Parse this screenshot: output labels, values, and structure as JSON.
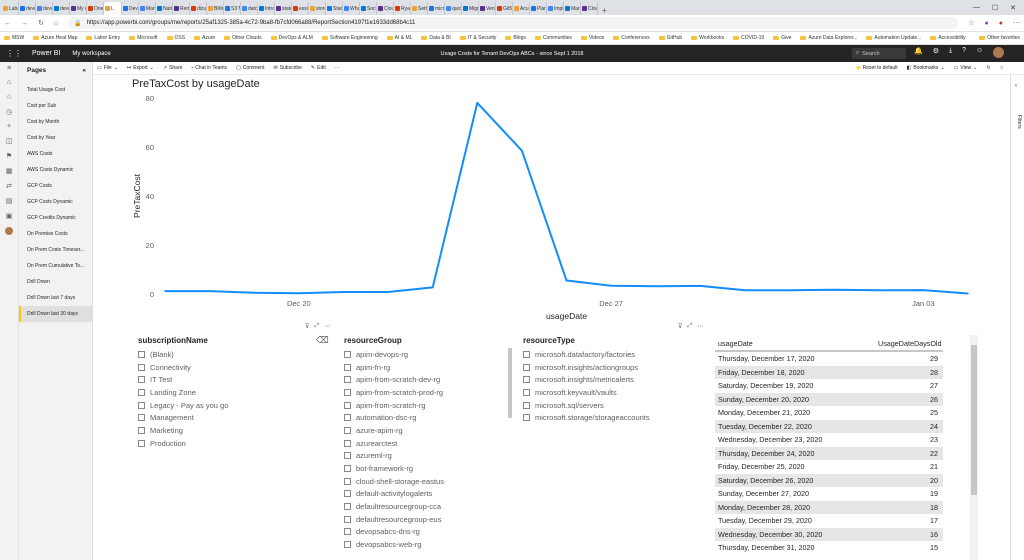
{
  "browser": {
    "tabs": [
      "Labo",
      "devo",
      "devo",
      "devo",
      "My o",
      "One",
      "L",
      "DevC",
      "Mark",
      "Nati",
      "Rem",
      "dizur",
      "Billin",
      "S3 N",
      "dato",
      "Intro",
      "stato",
      "essin",
      "store",
      "Stati",
      "What",
      "Socio",
      "Clou",
      "Ryan",
      "Settn",
      "micr",
      "quick",
      "Migr",
      "Venk",
      "Git5",
      "Acu",
      "Plan",
      "Impl",
      "Mark",
      "Clou"
    ],
    "url": "https://app.powerbi.com/groups/me/reports/25af1325-385a-4c72-9ba8-fb7cfd066a88/ReportSection4197f1e1633dd68b4c11",
    "bookmarks": [
      "MSW",
      "Azure Heat Map",
      "Labor Entry",
      "Microsoft",
      "OSS",
      "Azure",
      "Other Clouds",
      "DevOps & ALM",
      "Software Engineering",
      "AI & ML",
      "Data & BI",
      "IT & Security",
      "Blogs",
      "Communities",
      "Videos",
      "Conferences",
      "GitHub",
      "Workbooks",
      "COVID-19",
      "Give",
      "Azure Data Explorer...",
      "Automation Update...",
      "Accessibility"
    ],
    "other_favorites": "Other favorites"
  },
  "pbi": {
    "brand": "Power BI",
    "workspace": "My workspace",
    "report_title": "Usage Costs for Tenant DevOps ABCs - since Sept 1 2018",
    "search_placeholder": "Search"
  },
  "pages": {
    "header": "Pages",
    "items": [
      "Total Usage Cost",
      "Cost per Sub",
      "Cost by Month",
      "Cost by Year",
      "AWS Costs",
      "AWS Costs Dynamic",
      "GCP Costs",
      "GCP Costs Dynamic",
      "GCP Credits Dynamic",
      "On Premise Costs",
      "On Prem Costs Timeser...",
      "On Prem Cumulative To...",
      "Drill Down",
      "Drill Down last 7 days",
      "Drill Down last 30 days"
    ],
    "active_index": 14
  },
  "toolbar": {
    "file": "File",
    "export": "Export",
    "share": "Share",
    "chat": "Chat in Teams",
    "comment": "Comment",
    "subscribe": "Subscribe",
    "edit": "Edit",
    "more": "···",
    "reset": "Reset to default",
    "bookmarks": "Bookmarks",
    "view": "View"
  },
  "filters_label": "Filters",
  "chart_data": {
    "type": "line",
    "title": "PreTaxCost by usageDate",
    "xlabel": "usageDate",
    "ylabel": "PreTaxCost",
    "ylim": [
      0,
      80
    ],
    "yticks": [
      0,
      20,
      40,
      60,
      80
    ],
    "xticks": [
      "Dec 20",
      "Dec 27",
      "Jan 03"
    ],
    "color": "#118dff",
    "x": [
      "2020-12-17",
      "2020-12-18",
      "2020-12-19",
      "2020-12-20",
      "2020-12-21",
      "2020-12-22",
      "2020-12-23",
      "2020-12-24",
      "2020-12-25",
      "2020-12-26",
      "2020-12-27",
      "2020-12-28",
      "2020-12-29",
      "2020-12-30",
      "2020-12-31",
      "2021-01-01",
      "2021-01-02",
      "2021-01-03",
      "2021-01-04"
    ],
    "y": [
      1.2,
      1.2,
      0.5,
      0.3,
      0.8,
      0.8,
      2.7,
      78,
      58.5,
      5.5,
      3.4,
      3.2,
      3.3,
      1.5,
      1.5,
      1.7,
      1.5,
      1.6,
      0.2
    ]
  },
  "slicers": {
    "subscription": {
      "title": "subscriptionName",
      "items": [
        "(Blank)",
        "Connectivity",
        "IT Test",
        "Landing Zone",
        "Legacy - Pay as you go",
        "Management",
        "Marketing",
        "Production"
      ]
    },
    "resourceGroup": {
      "title": "resourceGroup",
      "items": [
        "apim-devops-rg",
        "apim-fn-rg",
        "apim-from-scratch-dev-rg",
        "apim-from-scratch-prod-rg",
        "apim-from-scratch-rg",
        "automation-dsc-rg",
        "azure-apim-rg",
        "azurearctest",
        "azureml-rg",
        "bot-framework-rg",
        "cloud-shell-storage-eastus",
        "default-activitylogalerts",
        "defaultresourcegroup-cca",
        "defaultresourcegroup-eus",
        "devopsabcs-dns-rg",
        "devopsabcs-web-rg"
      ]
    },
    "resourceType": {
      "title": "resourceType",
      "items": [
        "microsoft.datafactory/factories",
        "microsoft.insights/actiongroups",
        "microsoft.insights/metricalerts",
        "microsoft.keyvault/vaults",
        "microsoft.sql/servers",
        "microsoft.storage/storageaccounts"
      ]
    }
  },
  "table": {
    "headers": [
      "usageDate",
      "UsageDateDaysOld"
    ],
    "rows": [
      [
        "Thursday, December 17, 2020",
        "29"
      ],
      [
        "Friday, December 18, 2020",
        "28"
      ],
      [
        "Saturday, December 19, 2020",
        "27"
      ],
      [
        "Sunday, December 20, 2020",
        "26"
      ],
      [
        "Monday, December 21, 2020",
        "25"
      ],
      [
        "Tuesday, December 22, 2020",
        "24"
      ],
      [
        "Wednesday, December 23, 2020",
        "23"
      ],
      [
        "Thursday, December 24, 2020",
        "22"
      ],
      [
        "Friday, December 25, 2020",
        "21"
      ],
      [
        "Saturday, December 26, 2020",
        "20"
      ],
      [
        "Sunday, December 27, 2020",
        "19"
      ],
      [
        "Monday, December 28, 2020",
        "18"
      ],
      [
        "Tuesday, December 29, 2020",
        "17"
      ],
      [
        "Wednesday, December 30, 2020",
        "16"
      ],
      [
        "Thursday, December 31, 2020",
        "15"
      ]
    ]
  }
}
